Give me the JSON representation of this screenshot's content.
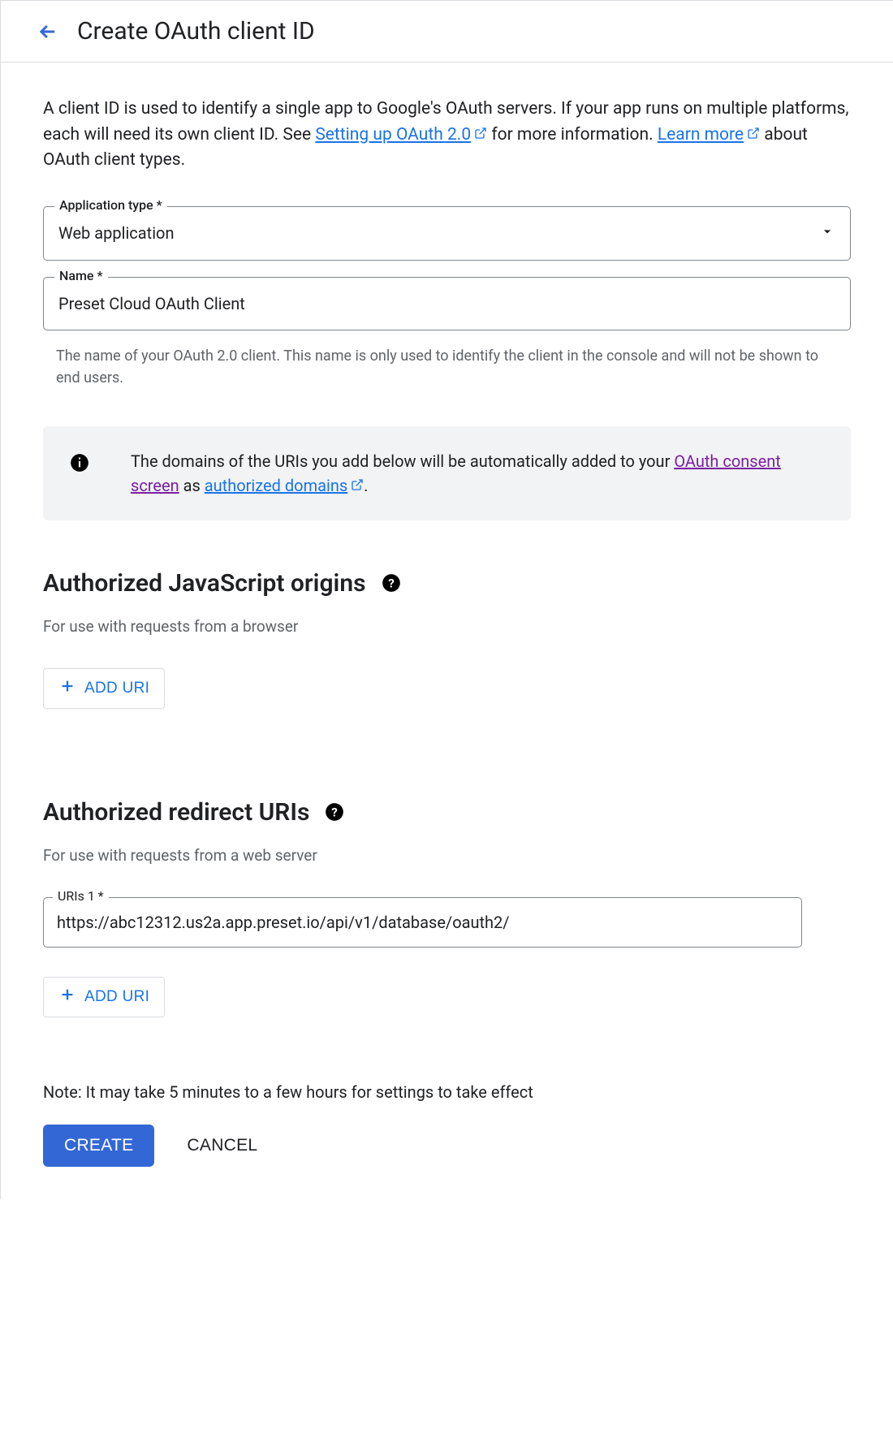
{
  "header": {
    "title": "Create OAuth client ID"
  },
  "intro": {
    "part1": "A client ID is used to identify a single app to Google's OAuth servers. If your app runs on multiple platforms, each will need its own client ID. See ",
    "link1": "Setting up OAuth 2.0",
    "part2": " for more information. ",
    "link2": "Learn more",
    "part3": " about OAuth client types."
  },
  "fields": {
    "app_type_label": "Application type *",
    "app_type_value": "Web application",
    "name_label": "Name *",
    "name_value": "Preset Cloud OAuth Client",
    "name_helper": "The name of your OAuth 2.0 client. This name is only used to identify the client in the console and will not be shown to end users."
  },
  "info": {
    "part1": "The domains of the URIs you add below will be automatically added to your ",
    "link1": "OAuth consent screen",
    "part2": " as ",
    "link2": "authorized domains",
    "part3": "."
  },
  "js_origins": {
    "title": "Authorized JavaScript origins",
    "subtitle": "For use with requests from a browser",
    "add_label": "ADD URI"
  },
  "redirect_uris": {
    "title": "Authorized redirect URIs",
    "subtitle": "For use with requests from a web server",
    "uri1_label": "URIs 1 *",
    "uri1_value": "https://abc12312.us2a.app.preset.io/api/v1/database/oauth2/",
    "add_label": "ADD URI"
  },
  "footer": {
    "note": "Note: It may take 5 minutes to a few hours for settings to take effect",
    "create_label": "CREATE",
    "cancel_label": "CANCEL"
  }
}
